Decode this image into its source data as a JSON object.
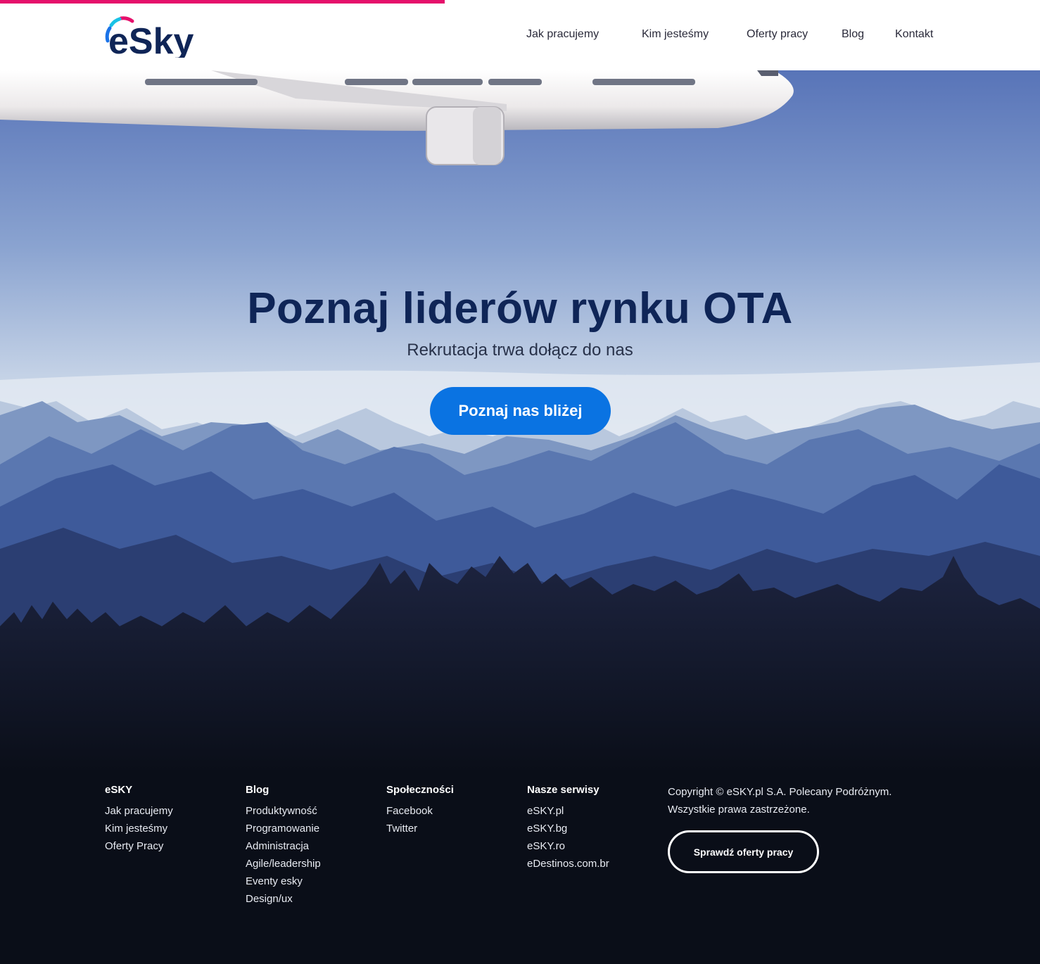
{
  "brand": {
    "logo_text": "eSky",
    "accent": "#e5106b",
    "primary": "#0f2557",
    "cta_color": "#0a73e2"
  },
  "nav": [
    {
      "label": "Jak pracujemy"
    },
    {
      "label": "Kim jesteśmy"
    },
    {
      "label": "Oferty pracy"
    },
    {
      "label": "Blog"
    },
    {
      "label": "Kontakt"
    }
  ],
  "hero": {
    "title": "Poznaj liderów rynku OTA",
    "subtitle": "Rekrutacja trwa dołącz do nas",
    "cta_label": "Poznaj nas bliżej"
  },
  "footer": {
    "columns": [
      {
        "heading": "eSKY",
        "links": [
          "Jak pracujemy",
          "Kim jesteśmy",
          "Oferty Pracy"
        ]
      },
      {
        "heading": "Blog",
        "links": [
          "Produktywność",
          "Programowanie",
          "Administracja",
          "Agile/leadership",
          "Eventy esky",
          "Design/ux"
        ]
      },
      {
        "heading": "Społeczności",
        "links": [
          "Facebook",
          "Twitter"
        ]
      },
      {
        "heading": "Nasze serwisy",
        "links": [
          "eSKY.pl",
          "eSKY.bg",
          "eSKY.ro",
          "eDestinos.com.br"
        ]
      }
    ],
    "copyright_line1": "Copyright © eSKY.pl S.A. Polecany Podróżnym.",
    "copyright_line2": "Wszystkie prawa zastrzeżone.",
    "jobs_button": "Sprawdź oferty pracy"
  }
}
